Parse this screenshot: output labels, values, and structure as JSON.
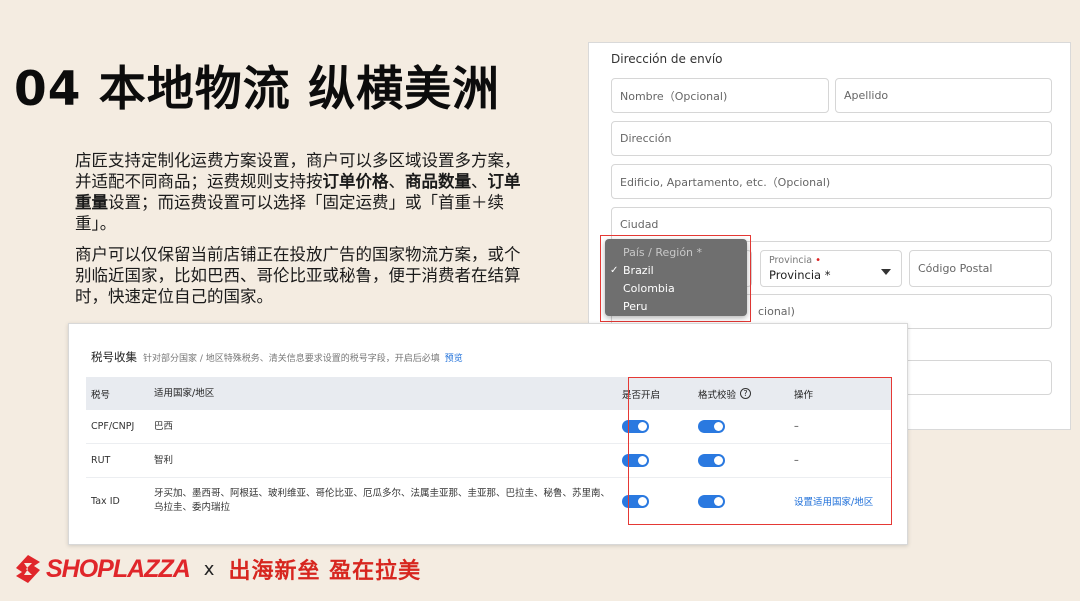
{
  "slide_title": "04 本地物流 纵横美洲",
  "description": {
    "p1_parts": [
      "店匠支持定制化运费方案设置，商户可以多区域设置多方案，并适配不同商品；运费规则支持按",
      "订单价格",
      "、",
      "商品数量",
      "、",
      "订单重量",
      "设置；而运费设置可以选择「固定运费」或「首重＋续重」。"
    ],
    "p2": "商户可以仅保留当前店铺正在投放广告的国家物流方案，或个别临近国家，比如巴西、哥伦比亚或秘鲁，便于消费者在结算时，快速定位自己的国家。"
  },
  "shipping_form": {
    "title": "Dirección de envío",
    "nombre_placeholder": "Nombre（Opcional)",
    "apellido_placeholder": "Apellido",
    "direccion_placeholder": "Dirección",
    "edificio_placeholder": "Edificio, Apartamento, etc.（Opcional)",
    "ciudad_placeholder": "Ciudad",
    "provincia_label": "Provincia",
    "provincia_required": "•",
    "provincia_value": "Provincia *",
    "codigo_postal_placeholder": "Código Postal",
    "hidden_field_partial": "cional)"
  },
  "country_dropdown": {
    "placeholder": "País / Región *",
    "options": [
      "Brazil",
      "Colombia",
      "Peru"
    ],
    "selected_check": "✓"
  },
  "tax_section": {
    "title": "税号收集",
    "subtitle": "针对部分国家 / 地区特殊税务、清关信息要求设置的税号字段，开启后必填",
    "preview_link": "预览",
    "columns": [
      "税号",
      "适用国家/地区",
      "是否开启",
      "格式校验",
      "操作"
    ],
    "help_symbol": "?",
    "rows": [
      {
        "tax_id": "CPF/CNPJ",
        "countries": "巴西",
        "action": "–"
      },
      {
        "tax_id": "RUT",
        "countries": "智利",
        "action": "–"
      },
      {
        "tax_id": "Tax ID",
        "countries": "牙买加、墨西哥、阿根廷、玻利维亚、哥伦比亚、厄瓜多尔、法属圭亚那、圭亚那、巴拉圭、秘鲁、苏里南、乌拉圭、委内瑞拉",
        "action": "设置适用国家/地区"
      }
    ],
    "toggle_state": "on"
  },
  "footer": {
    "brand": "SHOPLAZZA",
    "separator": "x",
    "slogan": "出海新垒 盈在拉美"
  },
  "colors": {
    "background": "#f4ece1",
    "accent_red": "#e53935",
    "toggle_blue": "#2a79e0",
    "link_blue": "#1e6fd9",
    "brand_red": "#e0262a"
  }
}
